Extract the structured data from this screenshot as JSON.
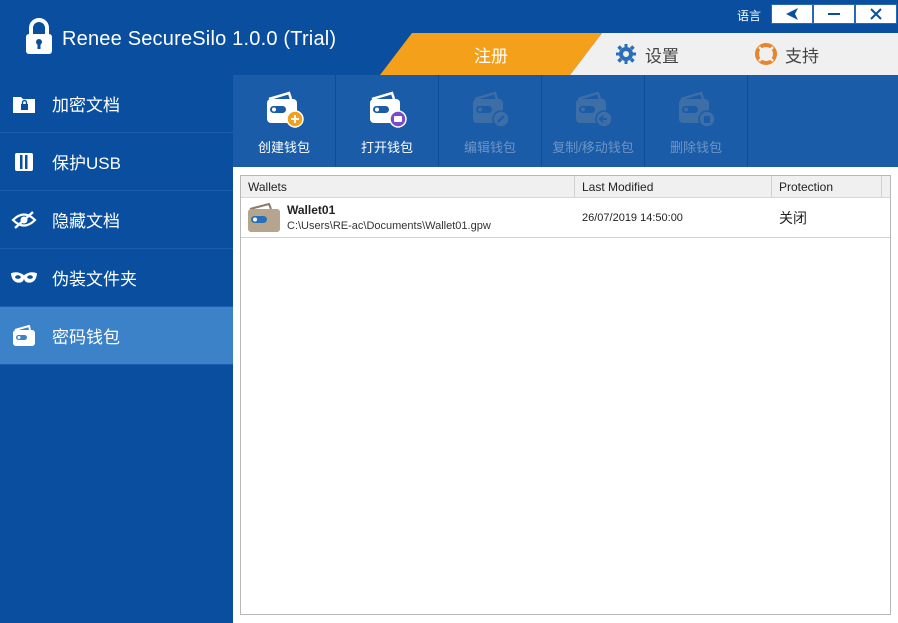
{
  "app": {
    "title": "Renee SecureSilo 1.0.0 (Trial)",
    "language_label": "语言"
  },
  "tabs": {
    "register": "注册",
    "settings": "设置",
    "support": "支持"
  },
  "sidebar": {
    "items": [
      {
        "label": "加密文档",
        "icon": "folder-lock-icon"
      },
      {
        "label": "保护USB",
        "icon": "usb-icon"
      },
      {
        "label": "隐藏文档",
        "icon": "eye-off-icon"
      },
      {
        "label": "伪装文件夹",
        "icon": "mask-icon"
      },
      {
        "label": "密码钱包",
        "icon": "wallet-icon"
      }
    ],
    "active_index": 4
  },
  "toolbar": {
    "buttons": [
      {
        "label": "创建钱包",
        "enabled": true
      },
      {
        "label": "打开钱包",
        "enabled": true
      },
      {
        "label": "编辑钱包",
        "enabled": false
      },
      {
        "label": "复制/移动钱包",
        "enabled": false
      },
      {
        "label": "删除钱包",
        "enabled": false
      }
    ]
  },
  "list": {
    "columns": [
      "Wallets",
      "Last Modified",
      "Protection"
    ],
    "rows": [
      {
        "name": "Wallet01",
        "path": "C:\\Users\\RE-ac\\Documents\\Wallet01.gpw",
        "modified": "26/07/2019 14:50:00",
        "protection": "关闭"
      }
    ]
  },
  "colors": {
    "brand_blue": "#0a4f9f",
    "toolbar_blue": "#1a5ca8",
    "active_item": "#3b82c9",
    "accent_orange": "#f5a01a"
  }
}
